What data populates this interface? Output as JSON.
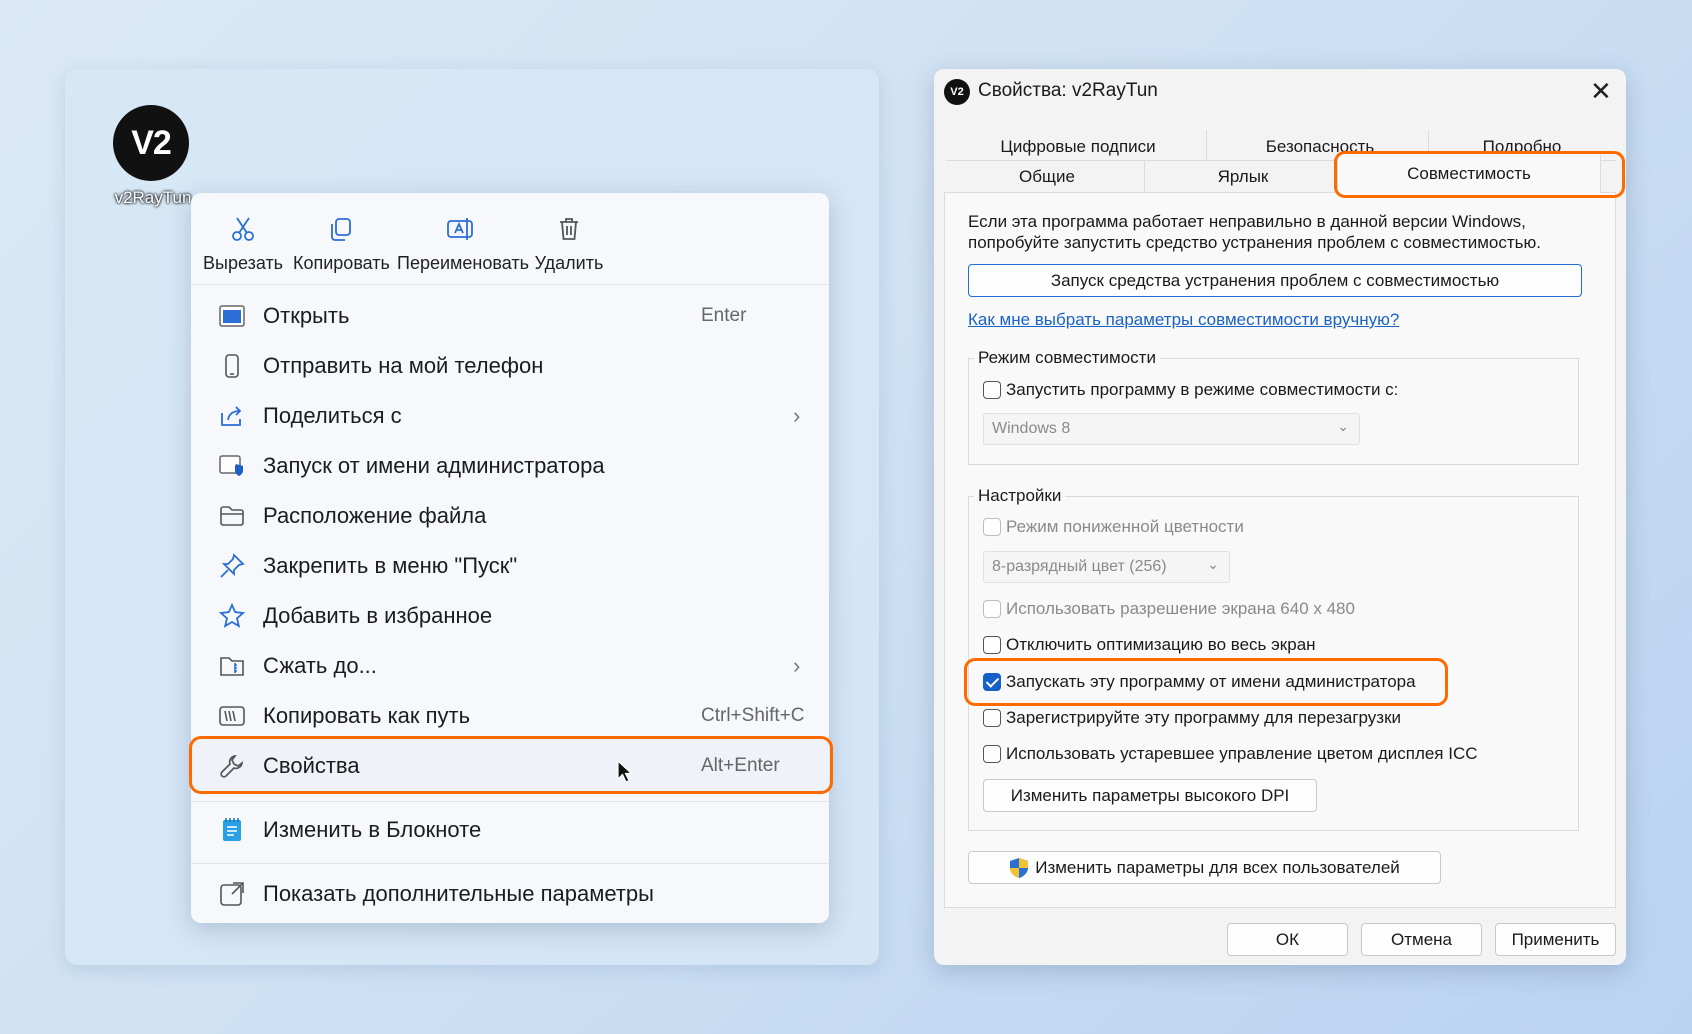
{
  "desktop": {
    "app_icon_text": "V2",
    "app_icon_label": "v2RayTun"
  },
  "context_menu": {
    "quick_actions": [
      {
        "label": "Вырезать",
        "icon": "scissors-icon"
      },
      {
        "label": "Копировать",
        "icon": "copy-icon"
      },
      {
        "label": "Переименовать",
        "icon": "rename-icon"
      },
      {
        "label": "Удалить",
        "icon": "trash-icon"
      }
    ],
    "items": [
      {
        "label": "Открыть",
        "shortcut": "Enter",
        "icon": "window-icon"
      },
      {
        "label": "Отправить на мой телефон",
        "shortcut": "",
        "icon": "phone-icon"
      },
      {
        "label": "Поделиться с",
        "shortcut": "",
        "icon": "share-icon",
        "submenu": true
      },
      {
        "label": "Запуск от имени администратора",
        "shortcut": "",
        "icon": "shield-icon"
      },
      {
        "label": "Расположение файла",
        "shortcut": "",
        "icon": "folder-icon"
      },
      {
        "label": "Закрепить в меню \"Пуск\"",
        "shortcut": "",
        "icon": "pin-icon"
      },
      {
        "label": "Добавить в избранное",
        "shortcut": "",
        "icon": "star-icon"
      },
      {
        "label": "Сжать до...",
        "shortcut": "",
        "icon": "archive-icon",
        "submenu": true
      },
      {
        "label": "Копировать как путь",
        "shortcut": "Ctrl+Shift+C",
        "icon": "path-icon"
      },
      {
        "label": "Свойства",
        "shortcut": "Alt+Enter",
        "icon": "wrench-icon"
      },
      {
        "label": "Изменить в Блокноте",
        "shortcut": "",
        "icon": "notepad-icon"
      },
      {
        "label": "Показать дополнительные параметры",
        "shortcut": "",
        "icon": "more-options-icon"
      }
    ]
  },
  "dialog": {
    "title_icon_text": "V2",
    "title": "Свойства: v2RayTun",
    "close_glyph": "✕",
    "tabs_row1": [
      "Цифровые подписи",
      "Безопасность",
      "Подробно"
    ],
    "tabs_row2": [
      "Общие",
      "Ярлык"
    ],
    "active_tab": "Совместимость",
    "intro_line1": "Если эта программа работает неправильно в данной версии Windows,",
    "intro_line2": "попробуйте запустить средство устранения проблем с совместимостью.",
    "troubleshooter_button": "Запуск средства устранения проблем с совместимостью",
    "help_link": "Как мне выбрать параметры совместимости вручную?",
    "compat_mode": {
      "group_label": "Режим совместимости",
      "checkbox_label": "Запустить программу в режиме совместимости с:",
      "checked": false,
      "os_value": "Windows 8"
    },
    "settings": {
      "group_label": "Настройки",
      "reduced_color": {
        "label": "Режим пониженной цветности",
        "checked": false,
        "disabled": true
      },
      "color_value": "8-разрядный цвет (256)",
      "res_640": {
        "label": "Использовать разрешение экрана 640 x 480",
        "checked": false,
        "disabled": true
      },
      "disable_fullscreen": {
        "label": "Отключить оптимизацию во весь экран",
        "checked": false
      },
      "run_as_admin": {
        "label": "Запускать эту программу от имени администратора",
        "checked": true
      },
      "register_restart": {
        "label": "Зарегистрируйте эту программу для перезагрузки",
        "checked": false
      },
      "legacy_icc": {
        "label": "Использовать устаревшее управление цветом дисплея ICC",
        "checked": false
      },
      "dpi_button": "Изменить параметры высокого DPI"
    },
    "all_users_button": "Изменить параметры для всех пользователей",
    "ok": "ОК",
    "cancel": "Отмена",
    "apply": "Применить"
  },
  "colors": {
    "highlight": "#ff6a00",
    "accent": "#1560c9",
    "link": "#1a62c7"
  }
}
